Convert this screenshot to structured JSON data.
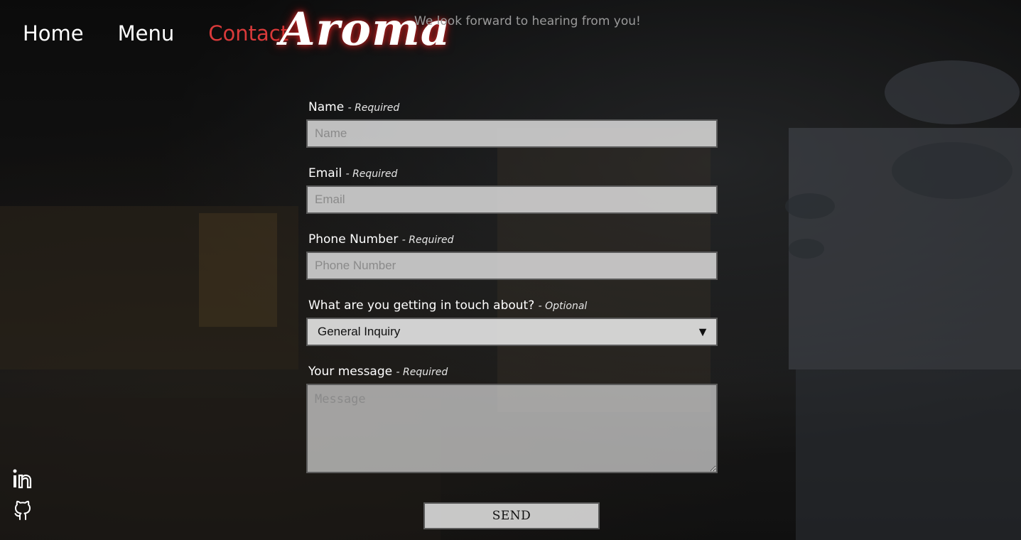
{
  "nav": {
    "items": [
      {
        "label": "Home"
      },
      {
        "label": "Menu"
      },
      {
        "label": "Contact"
      }
    ],
    "active": "Contact",
    "accent": "#d93a3a"
  },
  "brand": {
    "logo_text": "Aroma",
    "tagline": "We look forward to hearing from you!"
  },
  "form": {
    "name": {
      "label": "Name",
      "note": "- Required",
      "placeholder": "Name",
      "value": ""
    },
    "email": {
      "label": "Email",
      "note": "- Required",
      "placeholder": "Email",
      "value": ""
    },
    "phone": {
      "label": "Phone Number",
      "note": "- Required",
      "placeholder": "Phone Number",
      "value": ""
    },
    "topic": {
      "label": "What are you getting in touch about?",
      "note": "- Optional",
      "selected": "General Inquiry",
      "arrow": "▼"
    },
    "message": {
      "label": "Your message",
      "note": "- Required",
      "placeholder": "Message",
      "value": ""
    },
    "send_label": "SEND"
  },
  "social": [
    {
      "icon": "linkedin-icon"
    },
    {
      "icon": "github-icon"
    }
  ]
}
